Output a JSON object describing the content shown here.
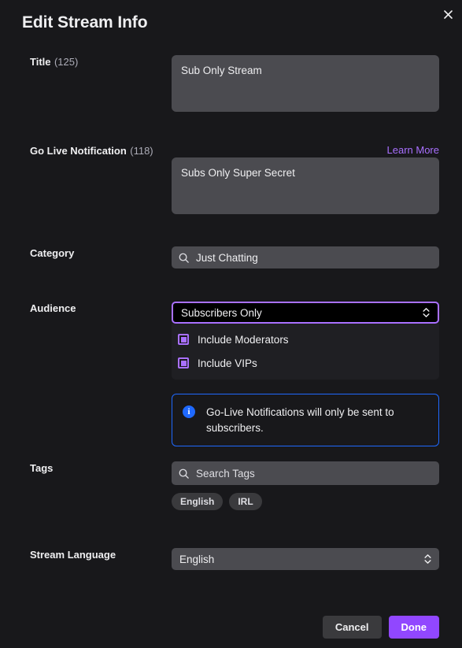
{
  "dialog": {
    "title": "Edit Stream Info",
    "close_icon": "close-icon"
  },
  "fields": {
    "title": {
      "label": "Title",
      "count": "(125)",
      "value": "Sub Only Stream"
    },
    "go_live": {
      "label": "Go Live Notification",
      "count": "(118)",
      "value": "Subs Only Super Secret",
      "learn_more": "Learn More"
    },
    "category": {
      "label": "Category",
      "value": "Just Chatting",
      "icon": "search-icon"
    },
    "audience": {
      "label": "Audience",
      "selected": "Subscribers Only",
      "options": [
        "Subscribers Only"
      ],
      "checkboxes": [
        {
          "label": "Include Moderators",
          "checked": true
        },
        {
          "label": "Include VIPs",
          "checked": true
        }
      ],
      "notice": "Go-Live Notifications will only be sent to subscribers."
    },
    "tags": {
      "label": "Tags",
      "placeholder": "Search Tags",
      "value": "",
      "icon": "search-icon",
      "pills": [
        "English",
        "IRL"
      ]
    },
    "language": {
      "label": "Stream Language",
      "selected": "English",
      "options": [
        "English"
      ]
    }
  },
  "footer": {
    "cancel": "Cancel",
    "done": "Done"
  },
  "colors": {
    "accent_purple": "#9147ff",
    "link_purple": "#a970ff",
    "info_blue": "#1f69ff",
    "page_bg": "#18181b",
    "field_bg": "#4b4b50"
  }
}
